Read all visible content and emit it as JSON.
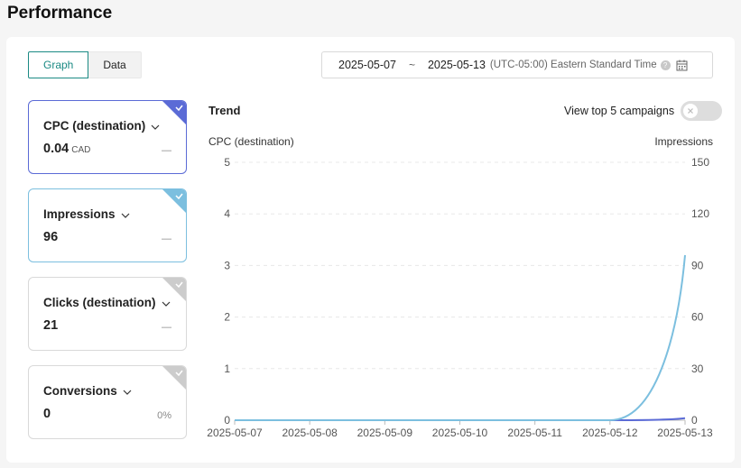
{
  "page": {
    "title": "Performance"
  },
  "view_toggle": {
    "graph": "Graph",
    "data": "Data"
  },
  "date_range": {
    "start": "2025-05-07",
    "separator": "~",
    "end": "2025-05-13",
    "timezone": "(UTC-05:00) Eastern Standard Time"
  },
  "metrics": [
    {
      "label": "CPC (destination)",
      "value": "0.04",
      "unit": "CAD",
      "delta": "—",
      "color": "#5b6bd6"
    },
    {
      "label": "Impressions",
      "value": "96",
      "unit": "",
      "delta": "—",
      "color": "#7cbfdf"
    },
    {
      "label": "Clicks (destination)",
      "value": "21",
      "unit": "",
      "delta": "—",
      "color": "#cccccc"
    },
    {
      "label": "Conversions",
      "value": "0",
      "unit": "",
      "delta": "0%",
      "color": "#cccccc"
    }
  ],
  "trend": {
    "title": "Trend",
    "toggle_label": "View top 5 campaigns"
  },
  "chart_data": {
    "type": "line",
    "x": [
      "2025-05-07",
      "2025-05-08",
      "2025-05-09",
      "2025-05-10",
      "2025-05-11",
      "2025-05-12",
      "2025-05-13"
    ],
    "y_left_label": "CPC (destination)",
    "y_right_label": "Impressions",
    "y_left_ticks": [
      0,
      1,
      2,
      3,
      4,
      5
    ],
    "y_right_ticks": [
      0,
      30,
      60,
      90,
      120,
      150
    ],
    "y_left_range": [
      0,
      5
    ],
    "y_right_range": [
      0,
      150
    ],
    "series": [
      {
        "axis": "left",
        "color": "#5b6bd6",
        "values": [
          0,
          0,
          0,
          0,
          0,
          0,
          0.04
        ]
      },
      {
        "axis": "right",
        "color": "#7cbfdf",
        "values": [
          0,
          0,
          0,
          0,
          0,
          0,
          96
        ]
      }
    ],
    "grid": true
  }
}
